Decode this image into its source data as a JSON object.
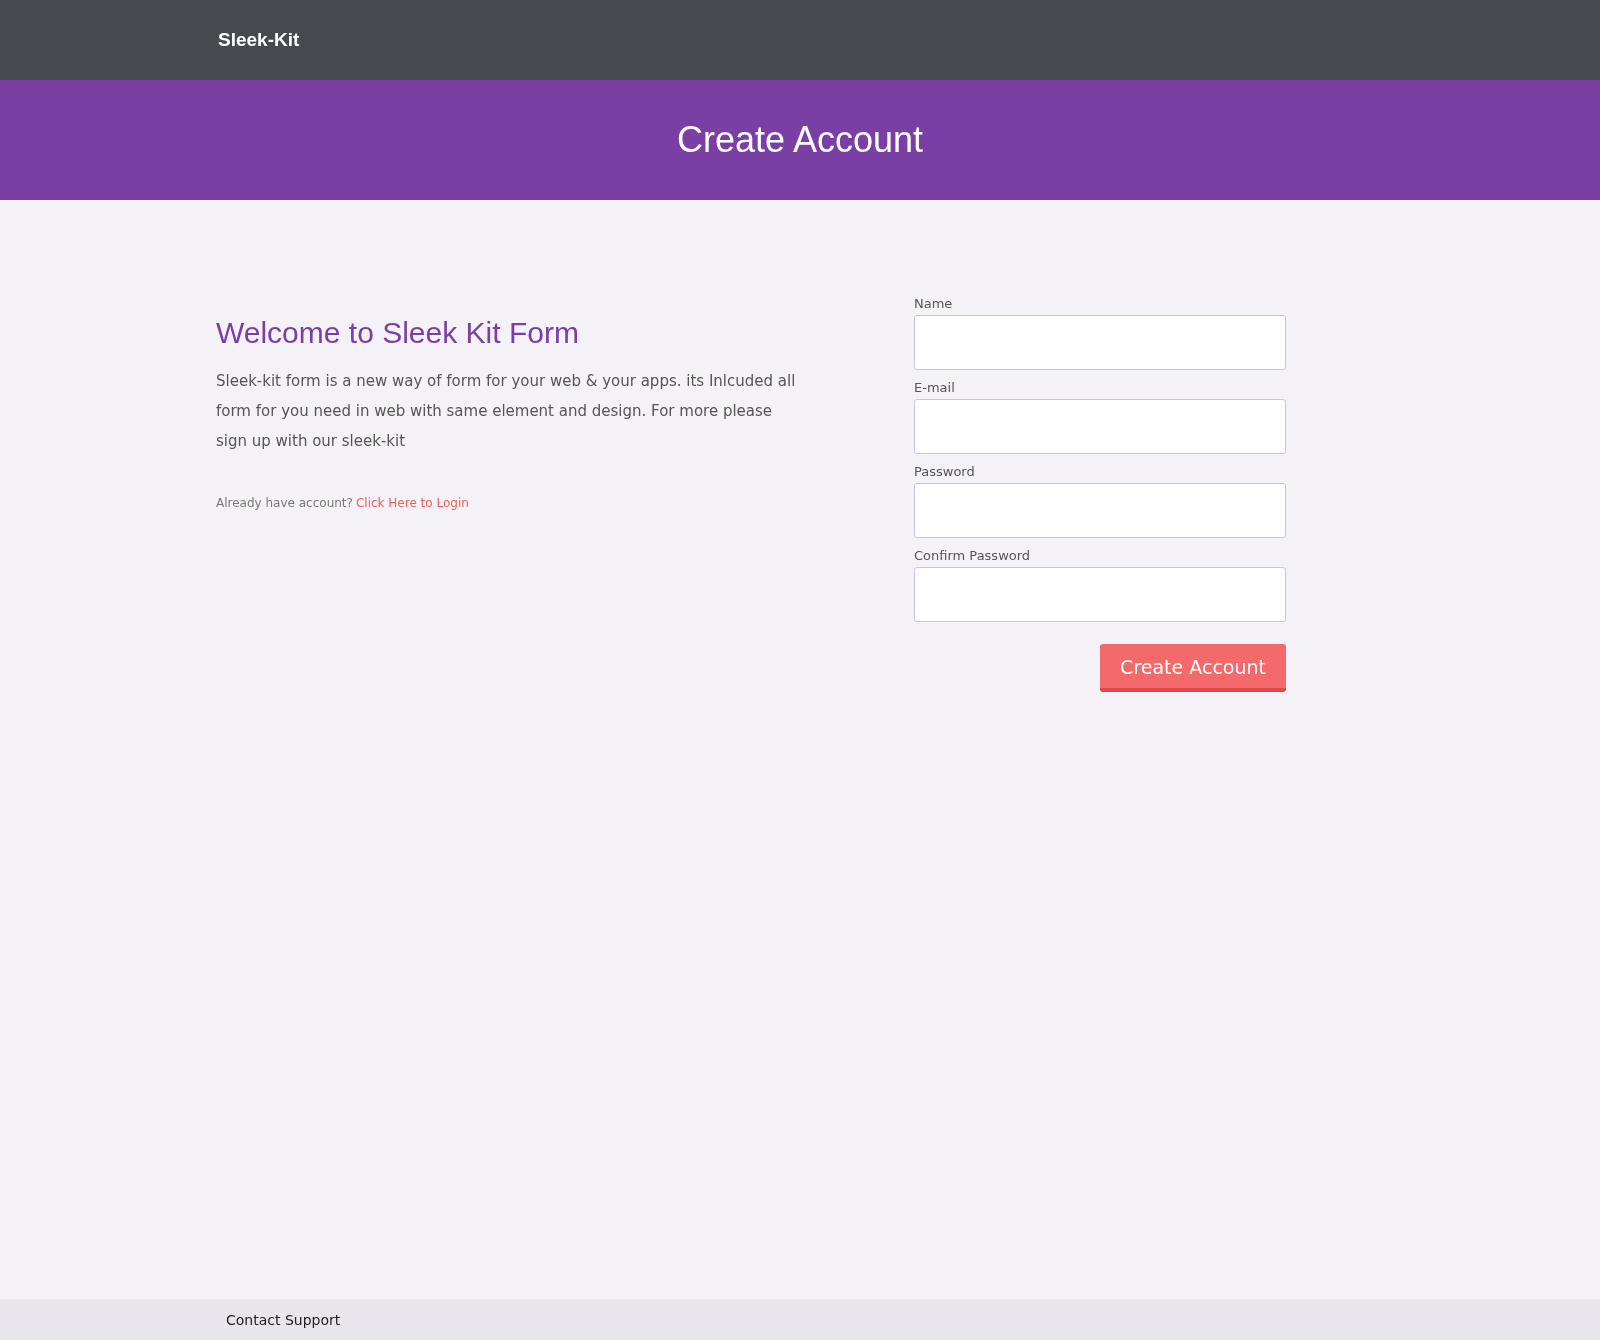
{
  "navbar": {
    "brand": "Sleek-Kit"
  },
  "banner": {
    "title": "Create Account"
  },
  "intro": {
    "heading": "Welcome to Sleek Kit Form",
    "text": "Sleek-kit form is a new way of form for your web & your apps. its Inlcuded all form for you need in web with same element and design. For more please sign up with our sleek-kit",
    "login_prompt": "Already have account?",
    "login_link": "Click Here to Login"
  },
  "form": {
    "fields": [
      {
        "label": "Name"
      },
      {
        "label": "E-mail"
      },
      {
        "label": "Password"
      },
      {
        "label": "Confirm Password"
      }
    ],
    "submit": "Create Account"
  },
  "footer": {
    "link": "Contact Support"
  }
}
